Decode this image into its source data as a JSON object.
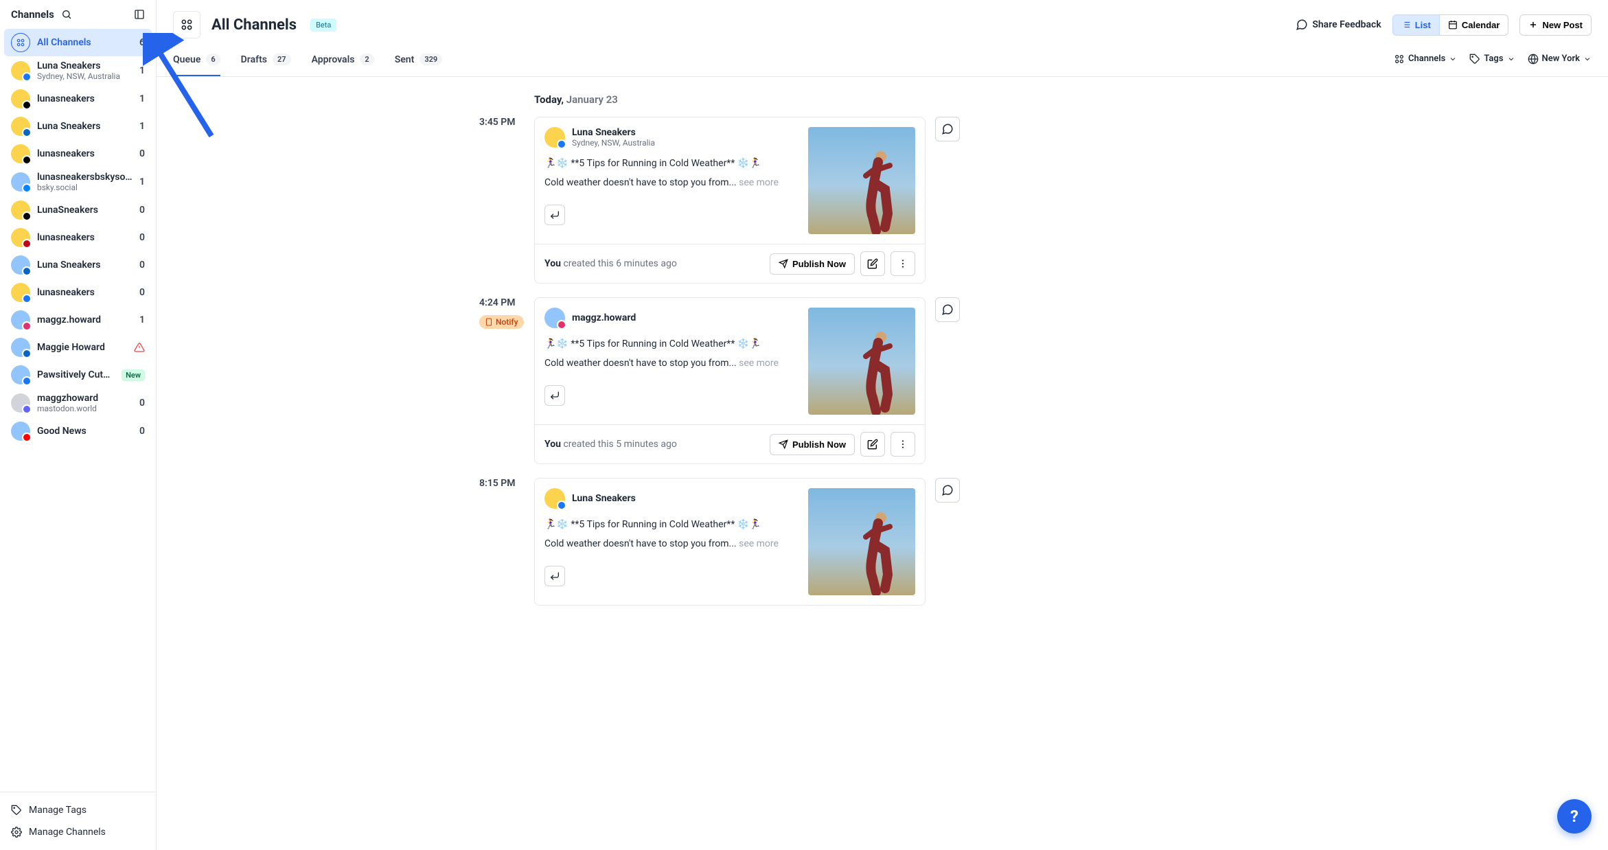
{
  "sidebar": {
    "title": "Channels",
    "footer": {
      "tags": "Manage Tags",
      "channels": "Manage Channels"
    },
    "items": [
      {
        "name": "All Channels",
        "count": "6",
        "avatar": "outline",
        "active": true
      },
      {
        "name": "Luna Sneakers",
        "sub": "Sydney, NSW, Australia",
        "count": "1",
        "avatar": "yellow",
        "badge": "#1877f2"
      },
      {
        "name": "lunasneakers",
        "count": "1",
        "avatar": "yellow",
        "badge": "#000000"
      },
      {
        "name": "Luna Sneakers",
        "count": "1",
        "avatar": "yellow",
        "badge": "#0a66c2"
      },
      {
        "name": "lunasneakers",
        "count": "0",
        "avatar": "yellow",
        "badge": "#000000"
      },
      {
        "name": "lunasneakersbskyso.bsky.s",
        "sub": "bsky.social",
        "count": "1",
        "avatar": "blue",
        "badge": "#0085ff"
      },
      {
        "name": "LunaSneakers",
        "count": "0",
        "avatar": "yellow",
        "badge": "#000000"
      },
      {
        "name": "lunasneakers",
        "count": "0",
        "avatar": "yellow",
        "badge": "#bd081c"
      },
      {
        "name": "Luna Sneakers",
        "count": "0",
        "avatar": "blue",
        "badge": "#0a66c2"
      },
      {
        "name": "lunasneakers",
        "count": "0",
        "avatar": "yellow",
        "badge": "#1877f2"
      },
      {
        "name": "maggz.howard",
        "count": "1",
        "avatar": "blue",
        "badge": "#e1306c"
      },
      {
        "name": "Maggie Howard",
        "avatar": "blue",
        "badge": "#0a66c2",
        "warn": true
      },
      {
        "name": "Pawsitively Cute Pets",
        "avatar": "blue",
        "badge": "#1877f2",
        "pill": "New"
      },
      {
        "name": "maggzhoward",
        "sub": "mastodon.world",
        "count": "0",
        "avatar": "gray",
        "badge": "#6364ff"
      },
      {
        "name": "Good News",
        "count": "0",
        "avatar": "blue",
        "badge": "#ff0000"
      }
    ]
  },
  "header": {
    "title": "All Channels",
    "beta": "Beta",
    "feedback": "Share Feedback",
    "list": "List",
    "calendar": "Calendar",
    "newPost": "New Post"
  },
  "tabs": [
    {
      "label": "Queue",
      "badge": "6",
      "active": true
    },
    {
      "label": "Drafts",
      "badge": "27"
    },
    {
      "label": "Approvals",
      "badge": "2"
    },
    {
      "label": "Sent",
      "badge": "329"
    }
  ],
  "filters": {
    "channels": "Channels",
    "tags": "Tags",
    "tz": "New York"
  },
  "date": {
    "strong": "Today,",
    "light": "January 23"
  },
  "posts": [
    {
      "time": "3:45 PM",
      "author": "Luna Sneakers",
      "sub": "Sydney, NSW, Australia",
      "avatar": "yellow",
      "badge": "#1877f2",
      "line1": "🏃‍♀️❄️ **5 Tips for Running in Cold Weather** ❄️🏃‍♀️",
      "line2": "Cold weather doesn't have to stop you from...",
      "seemore": "see more",
      "footerStrong": "You",
      "footerLight": " created this 6 minutes ago",
      "publish": "Publish Now"
    },
    {
      "time": "4:24 PM",
      "notify": "Notify",
      "author": "maggz.howard",
      "avatar": "blue",
      "badge": "#e1306c",
      "line1": "🏃‍♀️❄️ **5 Tips for Running in Cold Weather** ❄️🏃‍♀️",
      "line2": "Cold weather doesn't have to stop you from...",
      "seemore": "see more",
      "footerStrong": "You",
      "footerLight": " created this 5 minutes ago",
      "publish": "Publish Now"
    },
    {
      "time": "8:15 PM",
      "author": "Luna Sneakers",
      "avatar": "yellow",
      "badge": "#1877f2",
      "line1": "🏃‍♀️❄️ **5 Tips for Running in Cold Weather** ❄️🏃‍♀️",
      "line2": "Cold weather doesn't have to stop you from...",
      "seemore": "see more",
      "partial": true
    }
  ],
  "help": "?"
}
